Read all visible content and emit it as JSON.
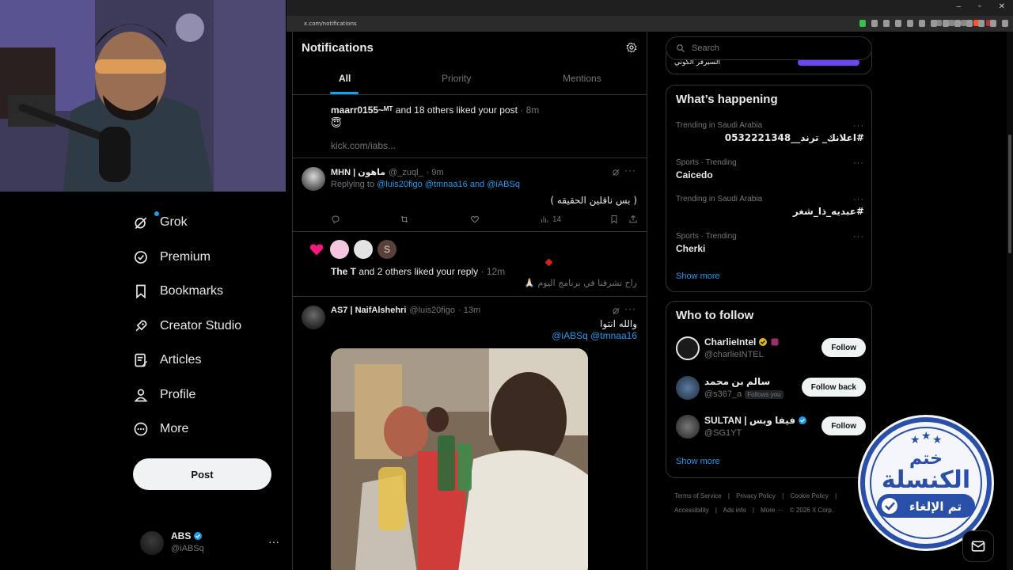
{
  "browser": {
    "url": "x.com/notifications"
  },
  "nav": {
    "items": [
      {
        "label": "Grok"
      },
      {
        "label": "Premium"
      },
      {
        "label": "Bookmarks"
      },
      {
        "label": "Creator Studio"
      },
      {
        "label": "Articles"
      },
      {
        "label": "Profile"
      },
      {
        "label": "More"
      }
    ],
    "post_label": "Post",
    "account": {
      "name": "ABS",
      "handle": "@iABSq"
    }
  },
  "notifications": {
    "title": "Notifications",
    "tabs": [
      "All",
      "Priority",
      "Mentions"
    ],
    "active_tab": "All",
    "items": [
      {
        "actor": "maarr0155~ᴹᵀ",
        "text": " and 18 others liked your post",
        "time": "· 8m",
        "emoji": "😇",
        "link": "kick.com/iabs..."
      },
      {
        "name": "MHN | ماهون",
        "handle": "@_zuql_",
        "time": "· 9m",
        "replying_prefix": "Replying to ",
        "replying_to": "@luis20figo @tmnaa16 and @iABSq",
        "body": "( بس ناقلين الحقيقه )",
        "views": "14"
      },
      {
        "actor": "The T",
        "text": " and 2 others liked your reply",
        "time": "· 12m",
        "quote": "راح تشرفنا في برنامج اليوم 🙏🏻",
        "faces": [
          "S"
        ]
      },
      {
        "name": "AS7 | NaifAlshehri",
        "handle": "@luis20figo",
        "time": "· 13m",
        "body": "والله انتوا",
        "mentions": "@iABSq @tmnaa16"
      }
    ]
  },
  "sidebar": {
    "search_placeholder": "Search",
    "prev_card_text": "السيرفر الكوني",
    "happening": {
      "title": "What’s happening",
      "trends": [
        {
          "meta": "Trending in Saudi Arabia",
          "name": "#اعلانك_ ترند__0532221348"
        },
        {
          "meta": "Sports · Trending",
          "name": "Caicedo"
        },
        {
          "meta": "Trending in Saudi Arabia",
          "name": "#عبديه_ذا_شغر"
        },
        {
          "meta": "Sports · Trending",
          "name": "Cherki"
        }
      ],
      "show_more": "Show more"
    },
    "who_to_follow": {
      "title": "Who to follow",
      "accounts": [
        {
          "name": "CharlieIntel",
          "handle": "@charlieINTEL",
          "button": "Follow"
        },
        {
          "name": "سالم بن محمد",
          "handle": "@s367_a",
          "badge": "Follows you",
          "button": "Follow back"
        },
        {
          "name": "SULTAN | فيفا وبس",
          "handle": "@SG1YT",
          "button": "Follow"
        }
      ],
      "show_more": "Show more"
    },
    "footer": [
      "Terms of Service",
      "|",
      "Privacy Policy",
      "|",
      "Cookie Policy",
      "|",
      "Accessibility",
      "|",
      "Ads info",
      "|",
      "More ···",
      "© 2026 X Corp."
    ]
  },
  "stamp": {
    "top": "ختم",
    "middle": "الكنسلة",
    "bottom": "تم الإلغاء"
  },
  "colors": {
    "accent": "#1d9bf0",
    "like": "#f91880",
    "verified_gold": "#e2b719"
  }
}
